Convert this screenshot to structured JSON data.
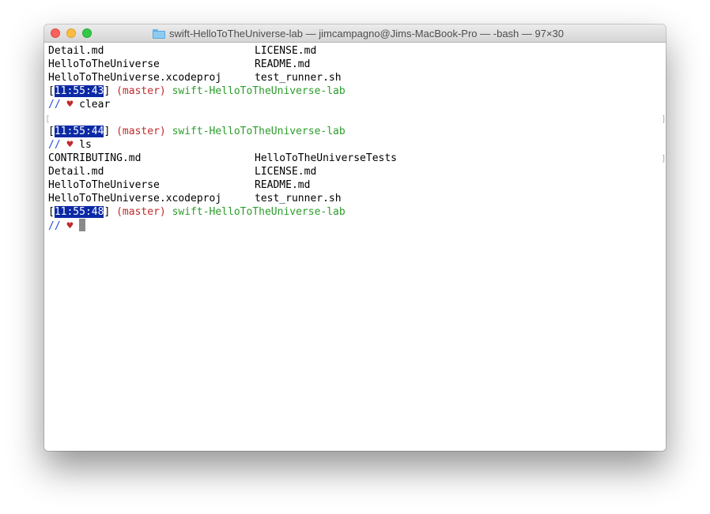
{
  "window": {
    "title": "swift-HelloToTheUniverse-lab — jimcampagno@Jims-MacBook-Pro — -bash — 97×30"
  },
  "prompt": {
    "branch": "(master)",
    "dir": "swift-HelloToTheUniverse-lab",
    "slashes": "//",
    "heart": "♥",
    "open_bracket": "[",
    "close_bracket": "]"
  },
  "terminal": {
    "top_listing": [
      [
        "Detail.md",
        "LICENSE.md"
      ],
      [
        "HelloToTheUniverse",
        "README.md"
      ],
      [
        "HelloToTheUniverse.xcodeproj",
        "test_runner.sh"
      ]
    ],
    "times": [
      "11:55:43",
      "11:55:44",
      "11:55:48"
    ],
    "commands": [
      "clear",
      "ls"
    ],
    "ls_listing": [
      [
        "CONTRIBUTING.md",
        "HelloToTheUniverseTests"
      ],
      [
        "Detail.md",
        "LICENSE.md"
      ],
      [
        "HelloToTheUniverse",
        "README.md"
      ],
      [
        "HelloToTheUniverse.xcodeproj",
        "test_runner.sh"
      ]
    ]
  },
  "colors": {
    "time_highlight": "#0c2aa6",
    "branch": "#c0292b",
    "dir": "#2b9d2b",
    "slashes": "#1f4bd8"
  }
}
